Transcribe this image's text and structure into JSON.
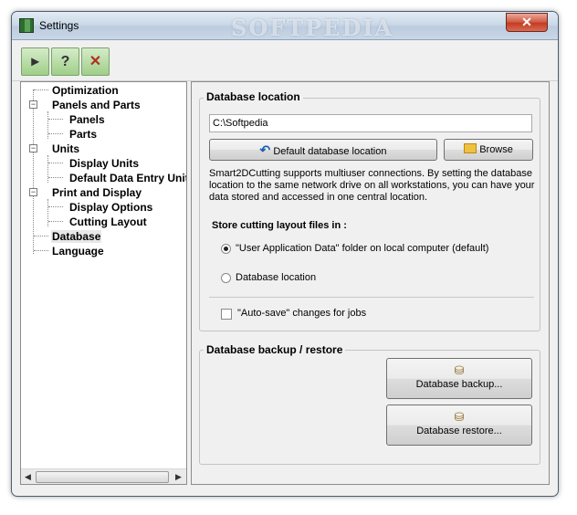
{
  "window": {
    "title": "Settings",
    "watermark": "SOFTPEDIA",
    "close_glyph": "✕"
  },
  "toolbar": {
    "buttons": [
      {
        "icon": "save-icon",
        "glyph": "▸"
      },
      {
        "icon": "help-icon",
        "glyph": "?"
      },
      {
        "icon": "exit-icon",
        "glyph": "✕"
      }
    ]
  },
  "tree": {
    "items": [
      {
        "label": "Optimization"
      },
      {
        "label": "Panels and Parts"
      },
      {
        "label": "Panels"
      },
      {
        "label": "Parts"
      },
      {
        "label": "Units"
      },
      {
        "label": "Display Units"
      },
      {
        "label": "Default Data Entry Units"
      },
      {
        "label": "Print and Display"
      },
      {
        "label": "Display Options"
      },
      {
        "label": "Cutting Layout"
      },
      {
        "label": "Database"
      },
      {
        "label": "Language"
      }
    ],
    "expander_glyph": "−",
    "scroll_left": "◀",
    "scroll_right": "▶"
  },
  "database_location": {
    "title": "Database location",
    "path_value": "C:\\Softpedia",
    "default_button": "Default database location",
    "browse_button": "Browse",
    "undo_glyph": "↶",
    "description": "Smart2DCutting supports multiuser connections. By setting the database location to the same network drive on all workstations, you can have your data stored and accessed in one central location.",
    "store_label": "Store cutting layout files in :",
    "option_local": "\"User Application Data\" folder on local computer (default)",
    "option_database": "Database location",
    "autosave_label": "\"Auto-save\" changes for jobs"
  },
  "backup": {
    "title": "Database backup / restore",
    "backup_button": "Database backup...",
    "restore_button": "Database restore...",
    "db_glyph": "⛁"
  }
}
